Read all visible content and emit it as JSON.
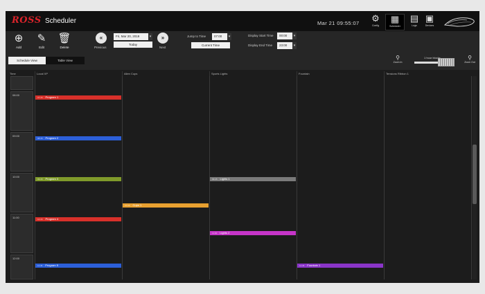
{
  "header": {
    "brand": "ROSS",
    "title": "Scheduler",
    "clock": "Mar 21 09:55:07",
    "nav": [
      {
        "label": "Config",
        "icon": "gear-icon"
      },
      {
        "label": "Scheduler",
        "icon": "calendar-icon"
      },
      {
        "label": "Logs",
        "icon": "document-icon"
      },
      {
        "label": "Devices",
        "icon": "devices-icon"
      }
    ]
  },
  "toolbar": {
    "add_label": "Add",
    "edit_label": "Edit",
    "delete_label": "Delete",
    "previous_label": "Previous",
    "next_label": "Next",
    "date_value": "Fri, Mar 20, 2019",
    "today_label": "Today",
    "jump_label": "Jump to Time",
    "jump_value": "07:00",
    "current_time_label": "Current Time",
    "start_label": "Display Start Time",
    "start_value": "00:00",
    "end_label": "Display End Time",
    "end_value": "23:00"
  },
  "views": {
    "schedule_view": "Schedule View",
    "table_view": "Table View",
    "zoom_in": "Zoom In",
    "zoom_out": "Zoom Out",
    "scale_label": "1 hour blocks"
  },
  "grid": {
    "time_header": "Time",
    "columns": [
      "Local XP",
      "Allen Cups",
      "Sports Lights",
      "Fountain",
      "Tensions Ribbon 1"
    ],
    "hours": [
      "08:00",
      "09:00",
      "10:00",
      "11:00",
      "12:00"
    ]
  },
  "events": [
    {
      "time": "07:45",
      "label": "Program 1",
      "color": "#d8302a"
    },
    {
      "time": "08:45",
      "label": "Program 2",
      "color": "#2c5fd8"
    },
    {
      "time": "09:45",
      "label": "Program 3",
      "color": "#7f9a2a"
    },
    {
      "time": "10:45",
      "label": "Program 4",
      "color": "#d8302a"
    },
    {
      "time": "11:45",
      "label": "Program 5",
      "color": "#2c5fd8"
    },
    {
      "time": "10:30",
      "label": "Cups 1",
      "color": "#e8a030"
    },
    {
      "time": "09:45",
      "label": "Lights 1",
      "color": "#7a7a7a"
    },
    {
      "time": "11:00",
      "label": "Lights 2",
      "color": "#c635c8"
    },
    {
      "time": "11:45",
      "label": "Fountain 1",
      "color": "#8a35c8"
    }
  ]
}
